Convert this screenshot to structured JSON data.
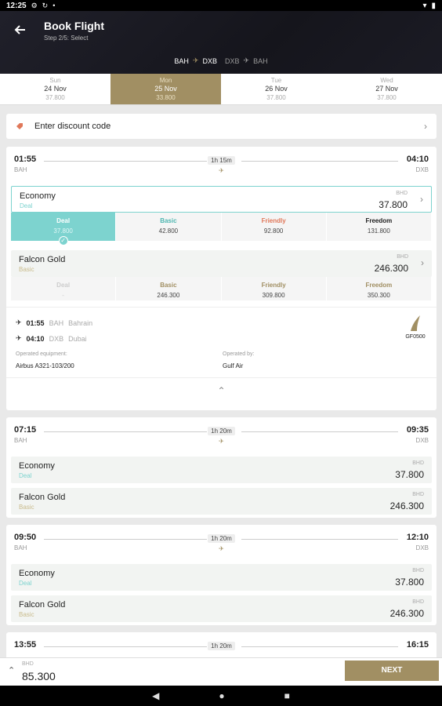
{
  "status": {
    "time": "12:25",
    "icons": [
      "gear-icon",
      "sync-icon",
      "wifi-icon",
      "battery-icon"
    ]
  },
  "header": {
    "title": "Book Flight",
    "step": "Step 2/5: Select"
  },
  "route": {
    "leg1_from": "BAH",
    "leg1_to": "DXB",
    "leg2_from": "DXB",
    "leg2_to": "BAH"
  },
  "dates": [
    {
      "day": "Sun",
      "date": "24 Nov",
      "price": "37.800"
    },
    {
      "day": "Mon",
      "date": "25 Nov",
      "price": "33.800"
    },
    {
      "day": "Tue",
      "date": "26 Nov",
      "price": "37.800"
    },
    {
      "day": "Wed",
      "date": "27 Nov",
      "price": "37.800"
    }
  ],
  "discount": {
    "label": "Enter discount code"
  },
  "flights": [
    {
      "dep": "01:55",
      "dep_code": "BAH",
      "arr": "04:10",
      "arr_code": "DXB",
      "duration": "1h 15m",
      "cabins": [
        {
          "name": "Economy",
          "sub": "Deal",
          "currency": "BHD",
          "price": "37.800"
        },
        {
          "name": "Falcon Gold",
          "sub": "Basic",
          "currency": "BHD",
          "price": "246.300"
        }
      ]
    },
    {
      "dep": "07:15",
      "dep_code": "BAH",
      "arr": "09:35",
      "arr_code": "DXB",
      "duration": "1h 20m",
      "cabins": [
        {
          "name": "Economy",
          "sub": "Deal",
          "currency": "BHD",
          "price": "37.800"
        },
        {
          "name": "Falcon Gold",
          "sub": "Basic",
          "currency": "BHD",
          "price": "246.300"
        }
      ]
    },
    {
      "dep": "09:50",
      "dep_code": "BAH",
      "arr": "12:10",
      "arr_code": "DXB",
      "duration": "1h 20m",
      "cabins": [
        {
          "name": "Economy",
          "sub": "Deal",
          "currency": "BHD",
          "price": "37.800"
        },
        {
          "name": "Falcon Gold",
          "sub": "Basic",
          "currency": "BHD",
          "price": "246.300"
        }
      ]
    },
    {
      "dep": "13:55",
      "duration": "1h 20m",
      "arr": "16:15"
    }
  ],
  "economy_fares": [
    {
      "name": "Deal",
      "price": "37.800"
    },
    {
      "name": "Basic",
      "price": "42.800"
    },
    {
      "name": "Friendly",
      "price": "92.800"
    },
    {
      "name": "Freedom",
      "price": "131.800"
    }
  ],
  "gold_fares": [
    {
      "name": "Deal",
      "price": "-"
    },
    {
      "name": "Basic",
      "price": "246.300"
    },
    {
      "name": "Friendly",
      "price": "309.800"
    },
    {
      "name": "Freedom",
      "price": "350.300"
    }
  ],
  "segment": {
    "dep_time": "01:55",
    "dep_code": "BAH",
    "dep_city": "Bahrain",
    "arr_time": "04:10",
    "arr_code": "DXB",
    "arr_city": "Dubai",
    "flight_no": "GF0500",
    "equipment_label": "Operated equipment:",
    "equipment": "Airbus A321-103/200",
    "operator_label": "Operated by:",
    "operator": "Gulf Air"
  },
  "bottom": {
    "currency": "BHD",
    "total": "85.300",
    "next": "NEXT"
  },
  "colors": {
    "gold": "#a18f63",
    "teal": "#7dd3cf",
    "friendly": "#e0785a",
    "header": "#1a1a22"
  }
}
